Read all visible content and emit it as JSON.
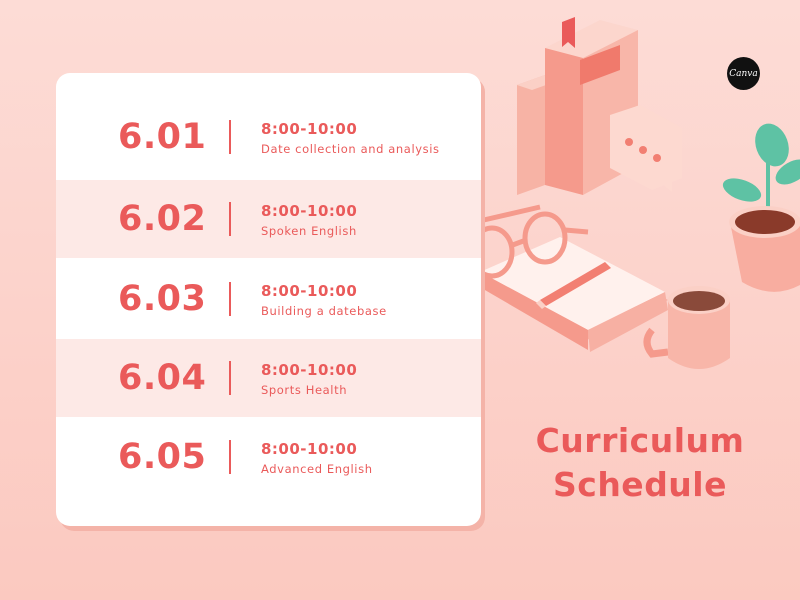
{
  "brand": {
    "logo_text": "Canva"
  },
  "schedule": {
    "rows": [
      {
        "date": "6.01",
        "time": "8:00-10:00",
        "course": "Date collection and analysis"
      },
      {
        "date": "6.02",
        "time": "8:00-10:00",
        "course": "Spoken English"
      },
      {
        "date": "6.03",
        "time": "8:00-10:00",
        "course": "Building a datebase"
      },
      {
        "date": "6.04",
        "time": "8:00-10:00",
        "course": "Sports Health"
      },
      {
        "date": "6.05",
        "time": "8:00-10:00",
        "course": "Advanced English"
      }
    ]
  },
  "heading": {
    "line1": "Curriculum",
    "line2": "Schedule"
  },
  "colors": {
    "accent": "#ea5a5a",
    "background": "#fddcd6",
    "row_alt": "#fde9e6",
    "leaf": "#5ec2a4"
  },
  "illustration": {
    "icons": [
      "books-icon",
      "speech-bubble-icon",
      "glasses-icon",
      "open-book-icon",
      "pen-icon",
      "coffee-mug-icon",
      "potted-plant-icon"
    ]
  }
}
